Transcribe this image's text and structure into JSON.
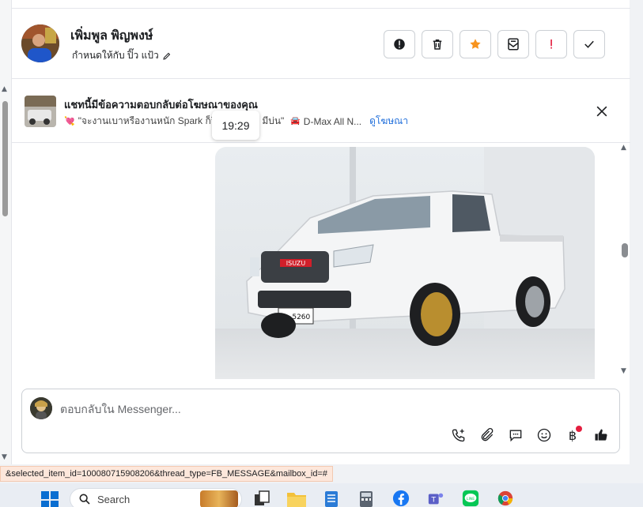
{
  "header": {
    "contact_name": "เพิ่มพูล พิญพงษ์",
    "assigned_text": "กำหนดให้กับ ปิ๊ว แป้ว",
    "actions": [
      "spam",
      "delete",
      "star",
      "mark-unread",
      "follow-up",
      "done"
    ]
  },
  "ad_banner": {
    "title": "แชทนี้มีข้อความตอบกลับต่อโฆษณาของคุณ",
    "subtitle_quote": "\"จะงานเบาหรืองานหนัก Spark ก็วิ่ง",
    "subtitle_tail": "มีบ่น\"",
    "car_model": "D-Max All N...",
    "view_ad_link": "ดูโฆษณา",
    "tooltip_time": "19:29"
  },
  "message": {
    "image_alt": "White Isuzu D-Max single cab pickup",
    "plate": "บว 5260",
    "brand_badge": "ISUZU"
  },
  "composer": {
    "placeholder": "ตอบกลับใน Messenger...",
    "tools": [
      "call",
      "attach",
      "saved-reply",
      "emoji",
      "payment",
      "like"
    ]
  },
  "status_url": "&selected_item_id=100080715908206&thread_type=FB_MESSAGE&mailbox_id=#",
  "taskbar": {
    "search_label": "Search"
  },
  "colors": {
    "accent": "#216fdb",
    "star": "#f7931e",
    "follow_up": "#e41e3f",
    "notification_dot": "#e41e3f",
    "line_green": "#06c755",
    "facebook_blue": "#1877f2"
  }
}
